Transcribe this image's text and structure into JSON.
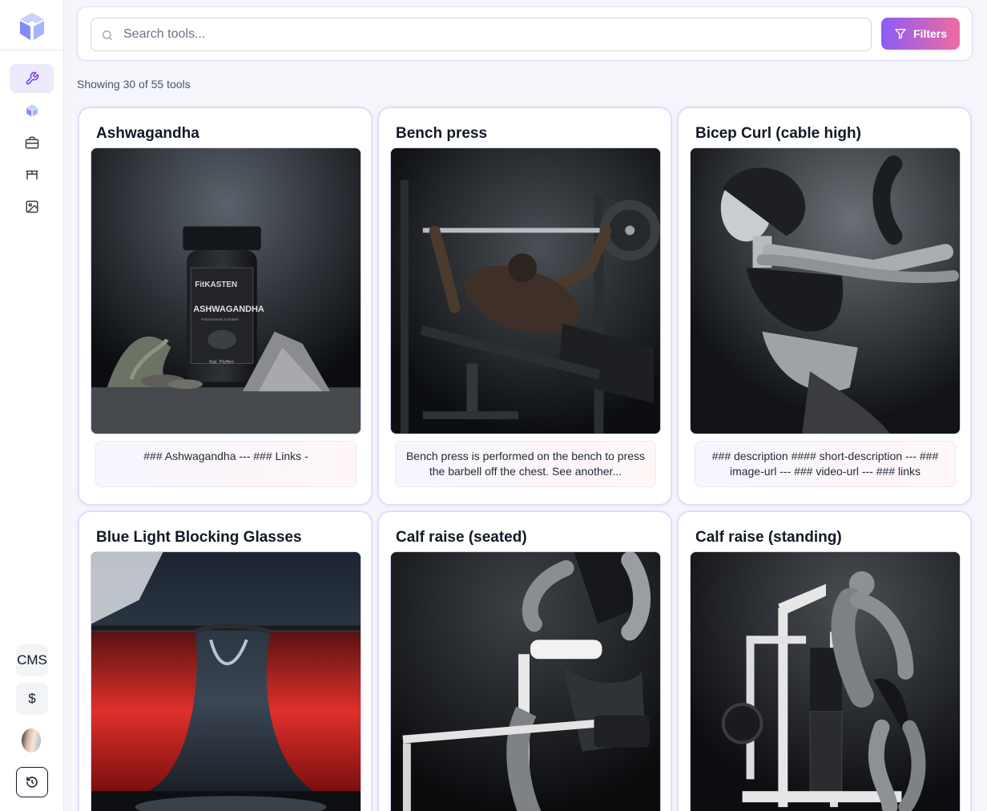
{
  "sidebar": {
    "logo_icon": "cube-logo-icon",
    "nav": [
      {
        "icon": "wrench-icon",
        "active": true
      },
      {
        "icon": "cube-icon",
        "active": false
      },
      {
        "icon": "briefcase-icon",
        "active": false
      },
      {
        "icon": "desk-icon",
        "active": false
      },
      {
        "icon": "image-icon",
        "active": false
      }
    ],
    "cms_label": "CMS",
    "pricing_label": "$",
    "avatar_icon": "user-avatar",
    "history_icon": "history-icon"
  },
  "search": {
    "placeholder": "Search tools...",
    "value": "",
    "filters_label": "Filters"
  },
  "results": {
    "count_text": "Showing 30 of 55 tools"
  },
  "cards": [
    {
      "title": "Ashwagandha",
      "description": "### Ashwagandha --- ### Links -"
    },
    {
      "title": "Bench press",
      "description": "Bench press is performed on the bench to press the barbell off the chest. See another..."
    },
    {
      "title": "Bicep Curl (cable high)",
      "description": "### description #### short-description --- ### image-url --- ### video-url --- ### links"
    },
    {
      "title": "Blue Light Blocking Glasses",
      "description": ""
    },
    {
      "title": "Calf raise (seated)",
      "description": ""
    },
    {
      "title": "Calf raise (standing)",
      "description": ""
    }
  ],
  "image_label_text": {
    "brand": "FitKASTEN",
    "product": "ASHWAGANDHA",
    "subline": "Pulverisierte Extrakte",
    "footer": "Nat. Plsffen"
  },
  "colors": {
    "accent": "#8b5cf6",
    "accent_pink": "#f06ba0",
    "active_nav_bg": "#ede9fe",
    "card_border": "#e4dcfa"
  }
}
